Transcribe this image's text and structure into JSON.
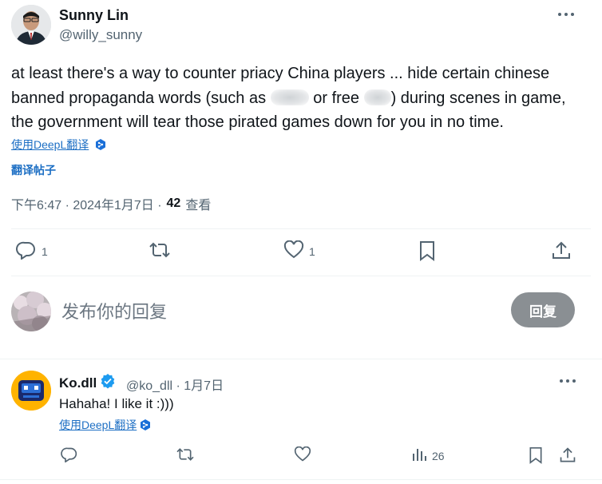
{
  "author": {
    "display_name": "Sunny Lin",
    "handle": "@willy_sunny"
  },
  "tweet": {
    "line1": "at least there's a way to counter priacy China players ... hide certain chinese",
    "line2_a": "banned propaganda words (such as ",
    "line2_b": " or free ",
    "line2_c": ") during scenes in game,",
    "line3": "the government will tear those pirated games down for you in no time.",
    "translate_link": "使用DeepL翻译",
    "translate_post": "翻译帖子",
    "time": "下午6:47 · 2024年1月7日 ·",
    "views_count": "42",
    "views_label": "查看"
  },
  "actions": {
    "reply_count": "1",
    "like_count": "1"
  },
  "composer": {
    "placeholder": "发布你的回复",
    "reply_button": "回复"
  },
  "reply": {
    "display_name": "Ko.dll",
    "handle_date": "@ko_dll · 1月7日",
    "text": "Hahaha! I like it :)))",
    "translate_link": "使用DeepL翻译",
    "views_count": "26"
  },
  "colors": {
    "link": "#1d6fc4",
    "muted": "#536471",
    "verified": "#1d9bf0",
    "reply_button": "#8a8f93"
  }
}
